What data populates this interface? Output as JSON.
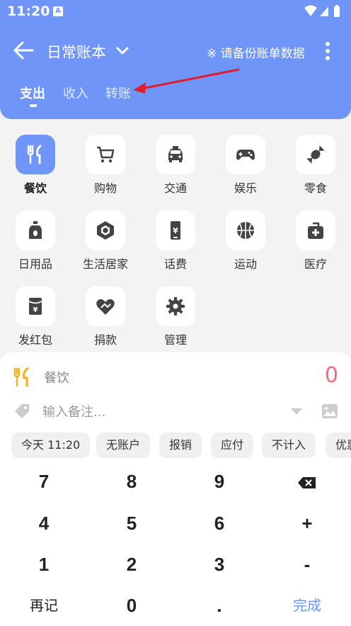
{
  "status": {
    "time": "11:20",
    "a_badge": "A"
  },
  "header": {
    "book_title": "日常账本",
    "backup_tip": "※ 请备份账单数据",
    "tabs": [
      {
        "label": "支出",
        "active": true
      },
      {
        "label": "收入",
        "active": false
      },
      {
        "label": "转账",
        "active": false
      }
    ],
    "accent_color": "#6e95f7",
    "annotation_arrow_color": "#e11d2a"
  },
  "categories": [
    {
      "label": "餐饮",
      "icon": "fork-knife-icon",
      "selected": true
    },
    {
      "label": "购物",
      "icon": "cart-icon"
    },
    {
      "label": "交通",
      "icon": "taxi-icon"
    },
    {
      "label": "娱乐",
      "icon": "gamepad-icon"
    },
    {
      "label": "零食",
      "icon": "candy-icon"
    },
    {
      "label": "日用品",
      "icon": "bottle-icon"
    },
    {
      "label": "生活居家",
      "icon": "house-cube-icon"
    },
    {
      "label": "话费",
      "icon": "phone-bill-icon"
    },
    {
      "label": "运动",
      "icon": "basketball-icon"
    },
    {
      "label": "医疗",
      "icon": "medical-kit-icon"
    },
    {
      "label": "发红包",
      "icon": "red-packet-icon"
    },
    {
      "label": "捐款",
      "icon": "donate-heart-icon"
    },
    {
      "label": "管理",
      "icon": "gear-icon"
    }
  ],
  "entry": {
    "category_name": "餐饮",
    "amount": "0",
    "note_placeholder": "输入备注...",
    "amount_color": "#f06a80"
  },
  "chips": [
    "今天 11:20",
    "无账户",
    "报销",
    "应付",
    "不计入",
    "优惠"
  ],
  "keypad": {
    "k7": "7",
    "k8": "8",
    "k9": "9",
    "k4": "4",
    "k5": "5",
    "k6": "6",
    "plus": "+",
    "k1": "1",
    "k2": "2",
    "k3": "3",
    "minus": "-",
    "again": "再记",
    "k0": "0",
    "dot": ".",
    "done": "完成"
  }
}
